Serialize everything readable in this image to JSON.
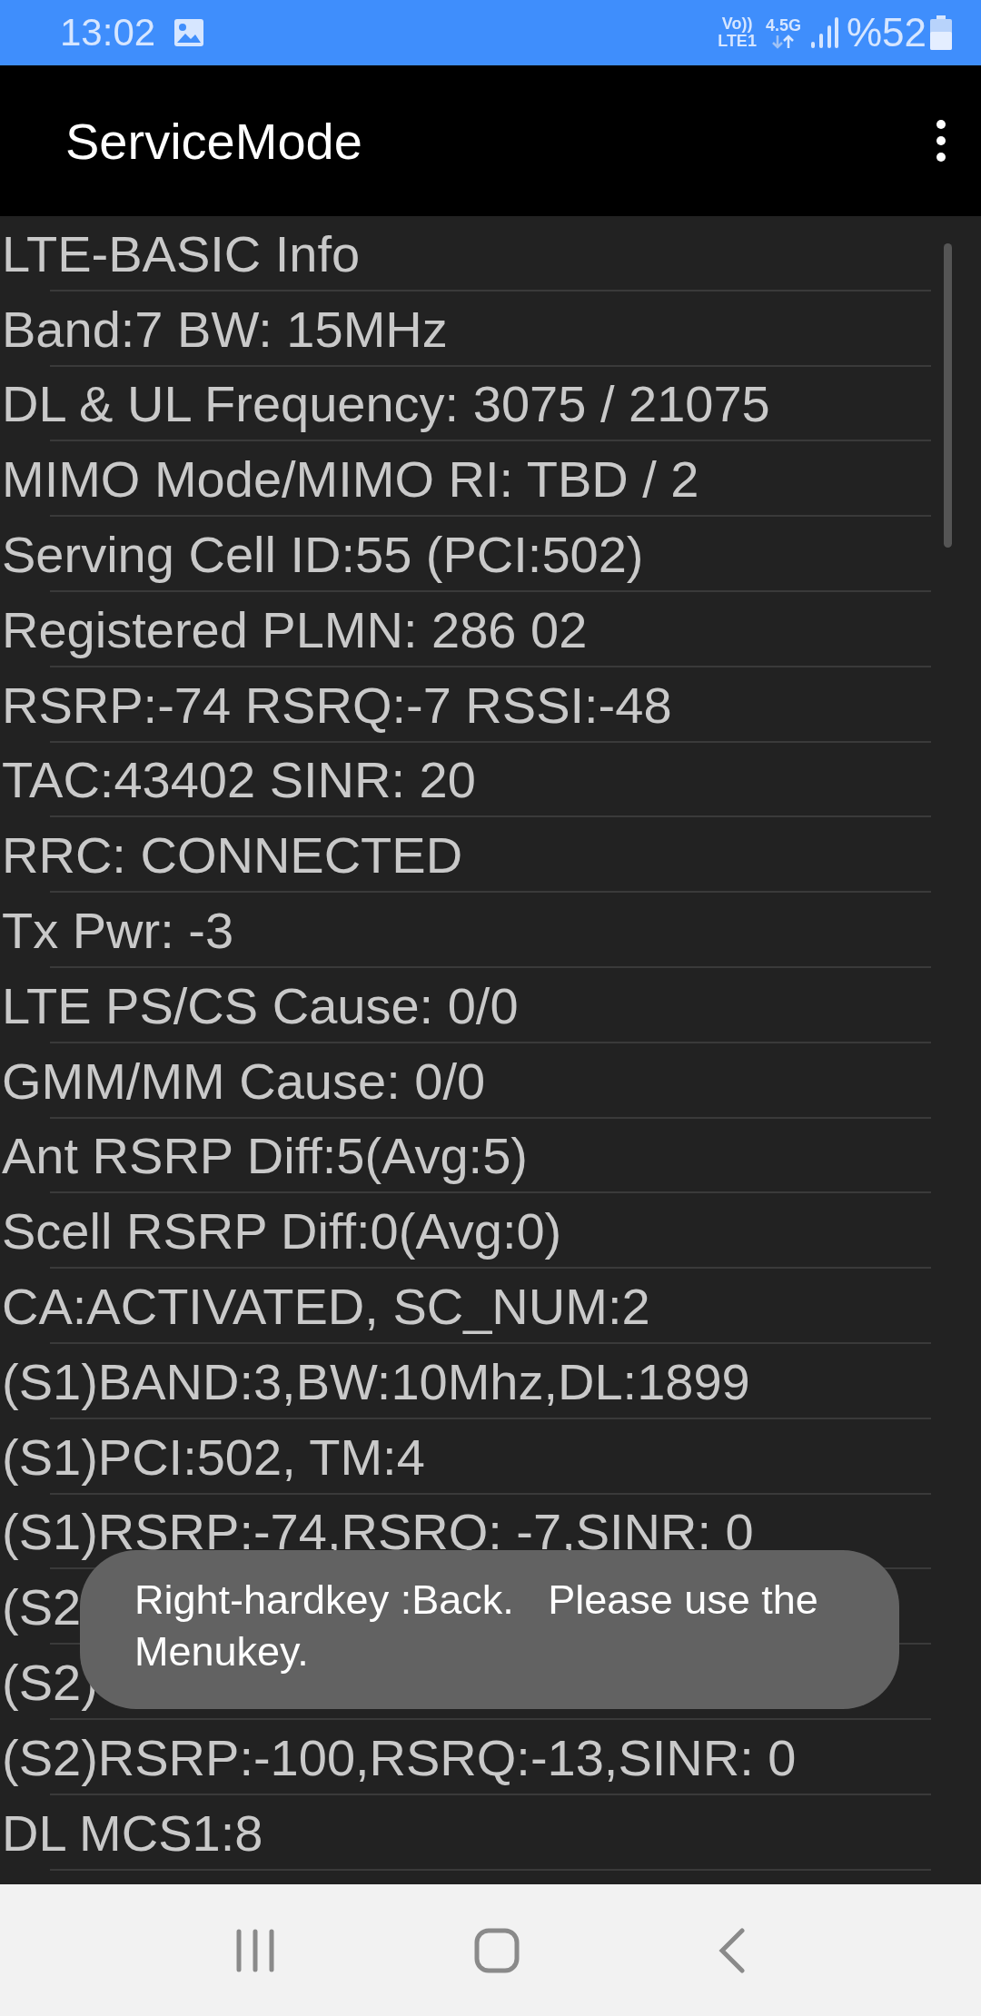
{
  "status_bar": {
    "time": "13:02",
    "volte": "Vo))",
    "sim": "LTE1",
    "network": "4.5G",
    "battery": "%52"
  },
  "app_bar": {
    "title": "ServiceMode"
  },
  "rows": [
    "LTE-BASIC Info",
    "Band:7 BW: 15MHz",
    "DL & UL Frequency: 3075 / 21075",
    "MIMO Mode/MIMO RI: TBD / 2",
    "Serving Cell ID:55 (PCI:502)",
    "Registered PLMN: 286 02",
    "RSRP:-74 RSRQ:-7 RSSI:-48",
    "TAC:43402 SINR: 20",
    "RRC: CONNECTED",
    "Tx Pwr: -3",
    "LTE PS/CS Cause: 0/0",
    "GMM/MM Cause: 0/0",
    "Ant RSRP Diff:5(Avg:5)",
    "Scell RSRP Diff:0(Avg:0)",
    "CA:ACTIVATED, SC_NUM:2",
    "(S1)BAND:3,BW:10Mhz,DL:1899",
    "(S1)PCI:502, TM:4",
    "(S1)RSRP:-74,RSRQ: -7,SINR:  0",
    "(S2",
    "(S2)",
    "(S2)RSRP:-100,RSRQ:-13,SINR:  0",
    "DL MCS1:8"
  ],
  "toast": "Right-hardkey :Back.   Please use the Menukey."
}
